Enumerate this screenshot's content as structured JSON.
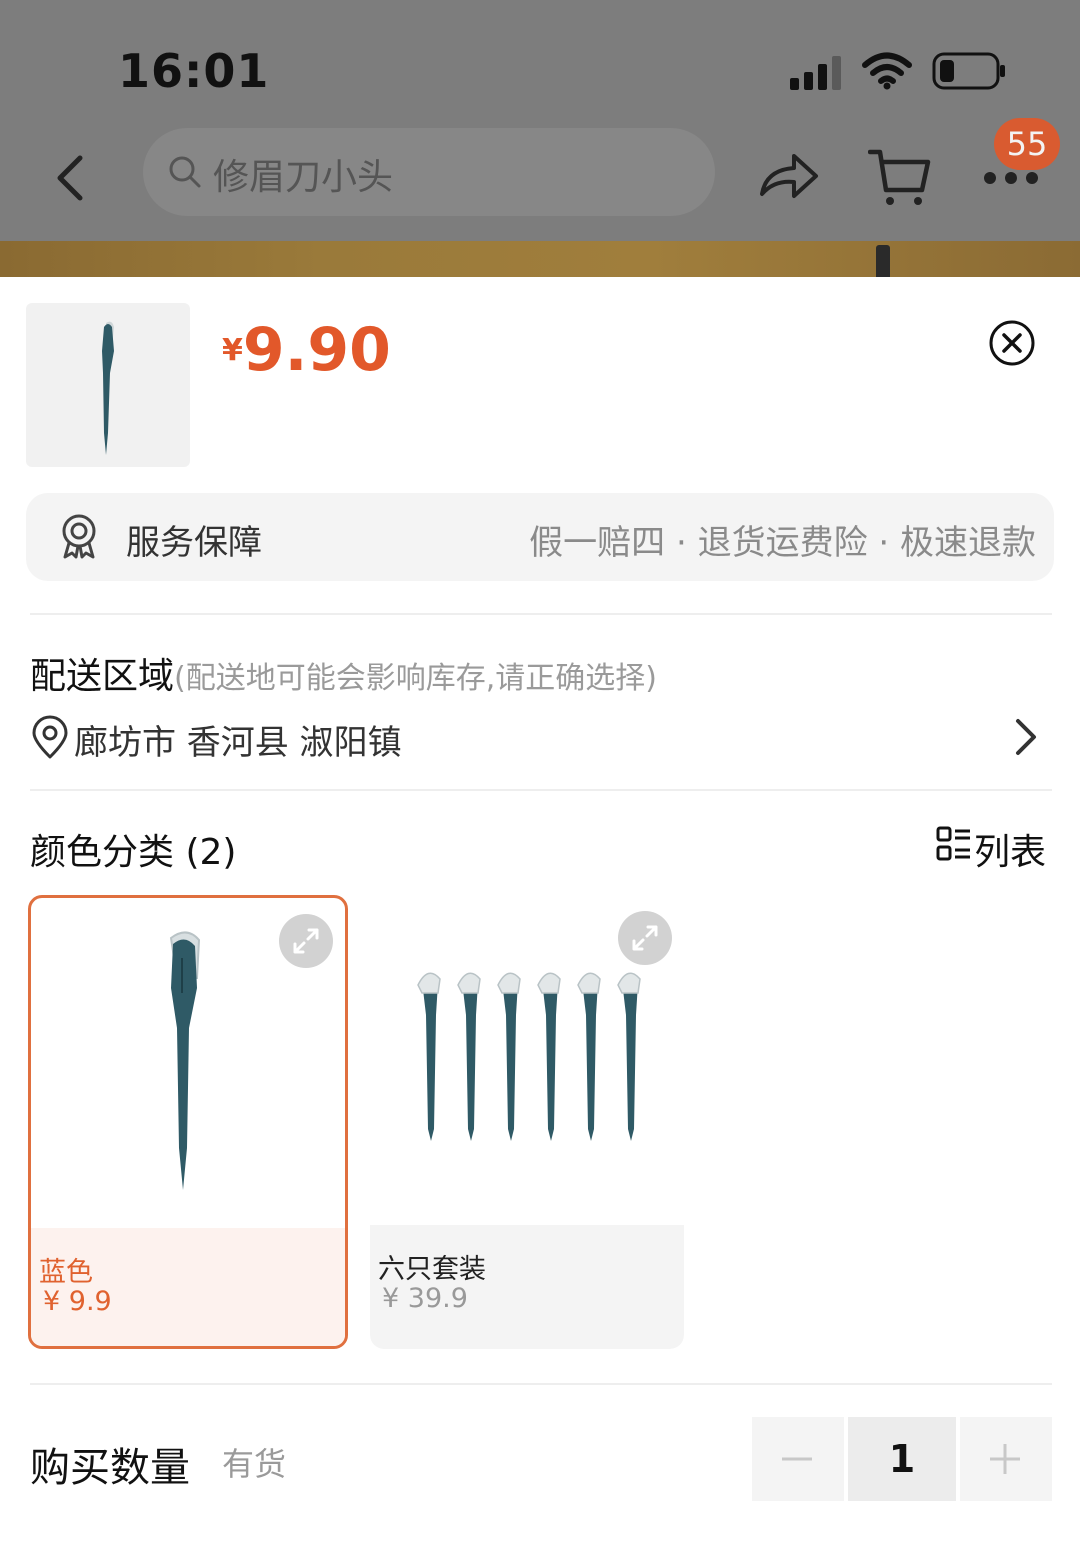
{
  "status_bar": {
    "time": "16:01"
  },
  "nav": {
    "search_text": "修眉刀小头",
    "badge_count": "55"
  },
  "product": {
    "currency": "¥",
    "price": "9.90"
  },
  "service": {
    "label": "服务保障",
    "items": "假一赔四 · 退货运费险 · 极速退款"
  },
  "delivery": {
    "title": "配送区域",
    "note": "(配送地可能会影响库存,请正确选择)",
    "address": "廊坊市 香河县 淑阳镇"
  },
  "variants": {
    "title": "颜色分类 (2)",
    "view_toggle": "列表",
    "items": [
      {
        "name": "蓝色",
        "price": "¥ 9.9",
        "selected": true
      },
      {
        "name": "六只套装",
        "price": "¥ 39.9",
        "selected": false
      }
    ]
  },
  "quantity": {
    "label": "购买数量",
    "stock": "有货",
    "value": "1"
  },
  "colors": {
    "accent": "#e2582a",
    "product_teal": "#2f5a66"
  }
}
